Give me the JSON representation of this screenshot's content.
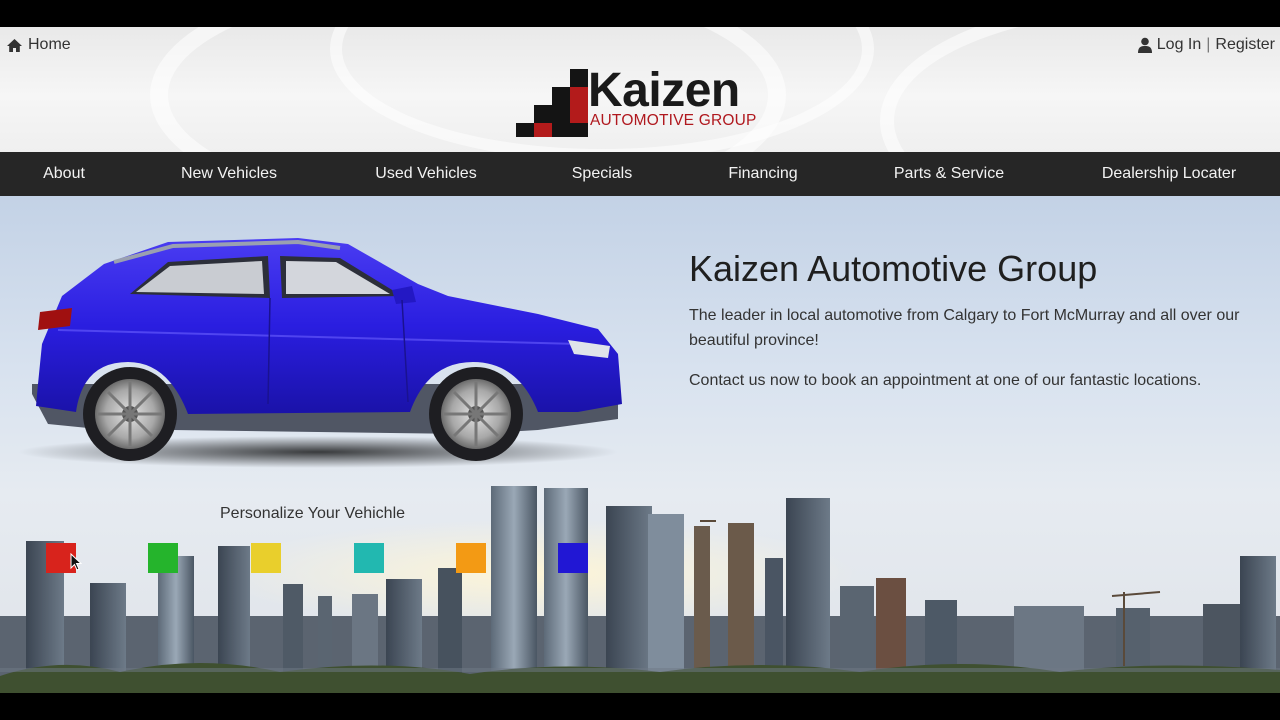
{
  "header": {
    "home_label": "Home",
    "login_label": "Log In",
    "separator": "|",
    "register_label": "Register",
    "logo": {
      "name": "Kaizen",
      "tagline": "AUTOMOTIVE GROUP"
    }
  },
  "nav": {
    "items": [
      {
        "label": "About"
      },
      {
        "label": "New Vehicles"
      },
      {
        "label": "Used Vehicles"
      },
      {
        "label": "Specials"
      },
      {
        "label": "Financing"
      },
      {
        "label": "Parts & Service"
      },
      {
        "label": "Dealership Locater"
      }
    ]
  },
  "hero": {
    "title": "Kaizen Automotive Group",
    "paragraph1": "The leader in local automotive from Calgary to Fort McMurray and all over our beautiful province!",
    "paragraph2": "Contact us now to book an appointment at one of our fantastic locations.",
    "car_color": "#2a1ee0"
  },
  "personalize": {
    "heading": "Personalize Your Vehichle",
    "swatches": [
      {
        "color": "#d8231c"
      },
      {
        "color": "#25b42c"
      },
      {
        "color": "#e9cf2c"
      },
      {
        "color": "#22b8b0"
      },
      {
        "color": "#f39a14"
      },
      {
        "color": "#2117d4"
      }
    ]
  },
  "icons": {
    "home": "home-icon",
    "user": "user-icon"
  }
}
